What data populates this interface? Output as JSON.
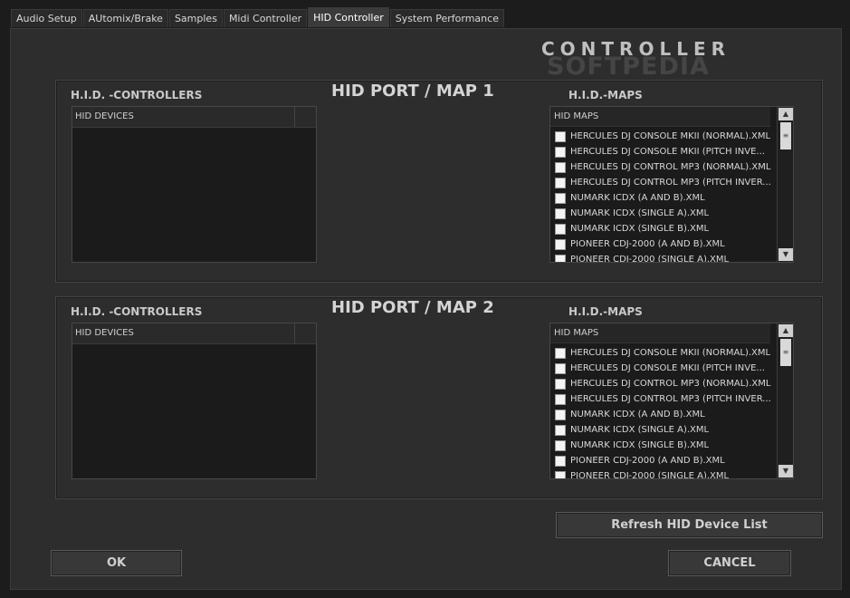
{
  "tabs": [
    {
      "label": "Audio Setup"
    },
    {
      "label": "AUtomix/Brake"
    },
    {
      "label": "Samples"
    },
    {
      "label": "Midi Controller"
    },
    {
      "label": "HID Controller",
      "active": true
    },
    {
      "label": "System Performance"
    }
  ],
  "heading": "CONTROLLER",
  "watermark": "SOFTPEDIA",
  "ports": [
    {
      "title": "HID PORT / MAP 1",
      "controllers_label": "H.I.D. -CONTROLLERS",
      "devices_header": "HID DEVICES",
      "maps_label": "H.I.D.-MAPS",
      "maps_header": "HID MAPS",
      "maps": [
        "HERCULES DJ CONSOLE MKII (NORMAL).XML",
        "HERCULES DJ CONSOLE MKII (PITCH INVE...",
        "HERCULES DJ CONTROL MP3 (NORMAL).XML",
        "HERCULES DJ CONTROL MP3 (PITCH INVER...",
        "NUMARK ICDX (A AND B).XML",
        "NUMARK ICDX (SINGLE A).XML",
        "NUMARK ICDX (SINGLE B).XML",
        "PIONEER CDJ-2000 (A AND B).XML",
        "PIONEER CDJ-2000 (SINGLE A).XML"
      ]
    },
    {
      "title": "HID PORT / MAP 2",
      "controllers_label": "H.I.D. -CONTROLLERS",
      "devices_header": "HID DEVICES",
      "maps_label": "H.I.D.-MAPS",
      "maps_header": "HID MAPS",
      "maps": [
        "HERCULES DJ CONSOLE MKII (NORMAL).XML",
        "HERCULES DJ CONSOLE MKII (PITCH INVE...",
        "HERCULES DJ CONTROL MP3 (NORMAL).XML",
        "HERCULES DJ CONTROL MP3 (PITCH INVER...",
        "NUMARK ICDX (A AND B).XML",
        "NUMARK ICDX (SINGLE A).XML",
        "NUMARK ICDX (SINGLE B).XML",
        "PIONEER CDJ-2000 (A AND B).XML",
        "PIONEER CDJ-2000 (SINGLE A).XML"
      ]
    }
  ],
  "buttons": {
    "refresh": "Refresh HID Device List",
    "ok": "OK",
    "cancel": "CANCEL"
  },
  "icons": {
    "scroll_up": "scroll-up-arrow-icon",
    "scroll_down": "scroll-down-arrow-icon",
    "checkbox": "checkbox-icon"
  }
}
